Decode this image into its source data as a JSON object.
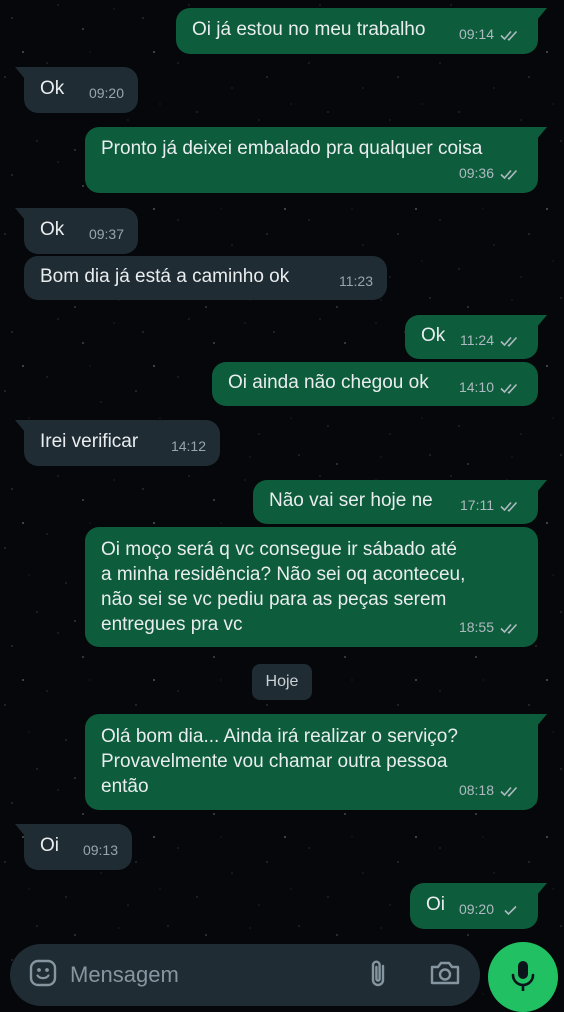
{
  "messages": [
    {
      "dir": "out",
      "text": "Oi já estou no meu trabalho",
      "time": "09:14",
      "status": "read"
    },
    {
      "dir": "in",
      "text": "Ok",
      "time": "09:20"
    },
    {
      "dir": "out",
      "text": "Pronto já deixei embalado pra qualquer coisa",
      "time": "09:36",
      "status": "read"
    },
    {
      "dir": "in",
      "text": "Ok",
      "time": "09:37"
    },
    {
      "dir": "in",
      "text": "Bom dia já está a caminho ok",
      "time": "11:23"
    },
    {
      "dir": "out",
      "text": "Ok",
      "time": "11:24",
      "status": "read"
    },
    {
      "dir": "out",
      "text": "Oi ainda não chegou ok",
      "time": "14:10",
      "status": "read"
    },
    {
      "dir": "in",
      "text": "Irei verificar",
      "time": "14:12"
    },
    {
      "dir": "out",
      "text": "Não vai ser hoje ne",
      "time": "17:11",
      "status": "read"
    },
    {
      "dir": "out",
      "text": "Oi moço será q vc consegue ir sábado até\na minha residência? Não sei oq aconteceu,\nnão sei se vc pediu para as peças serem\nentregues pra vc",
      "time": "18:55",
      "status": "read"
    },
    {
      "dir": "out",
      "text": "Olá bom dia... Ainda irá realizar o serviço?\nProvavelmente vou chamar outra pessoa\nentão",
      "time": "08:18",
      "status": "read"
    },
    {
      "dir": "in",
      "text": "Oi",
      "time": "09:13"
    },
    {
      "dir": "out",
      "text": "Oi",
      "time": "09:20",
      "status": "sent"
    }
  ],
  "date_separator": "Hoje",
  "composer": {
    "placeholder": "Mensagem"
  },
  "icons": {
    "emoji": "emoji-icon",
    "attach": "paperclip-icon",
    "camera": "camera-icon",
    "mic": "microphone-icon",
    "read_ticks": "double-check-icon",
    "sent_tick": "single-check-icon"
  },
  "colors": {
    "bubble_out": "#0d5c3b",
    "bubble_in": "#202c33",
    "mic_button": "#21c063",
    "text": "#e9edef"
  }
}
